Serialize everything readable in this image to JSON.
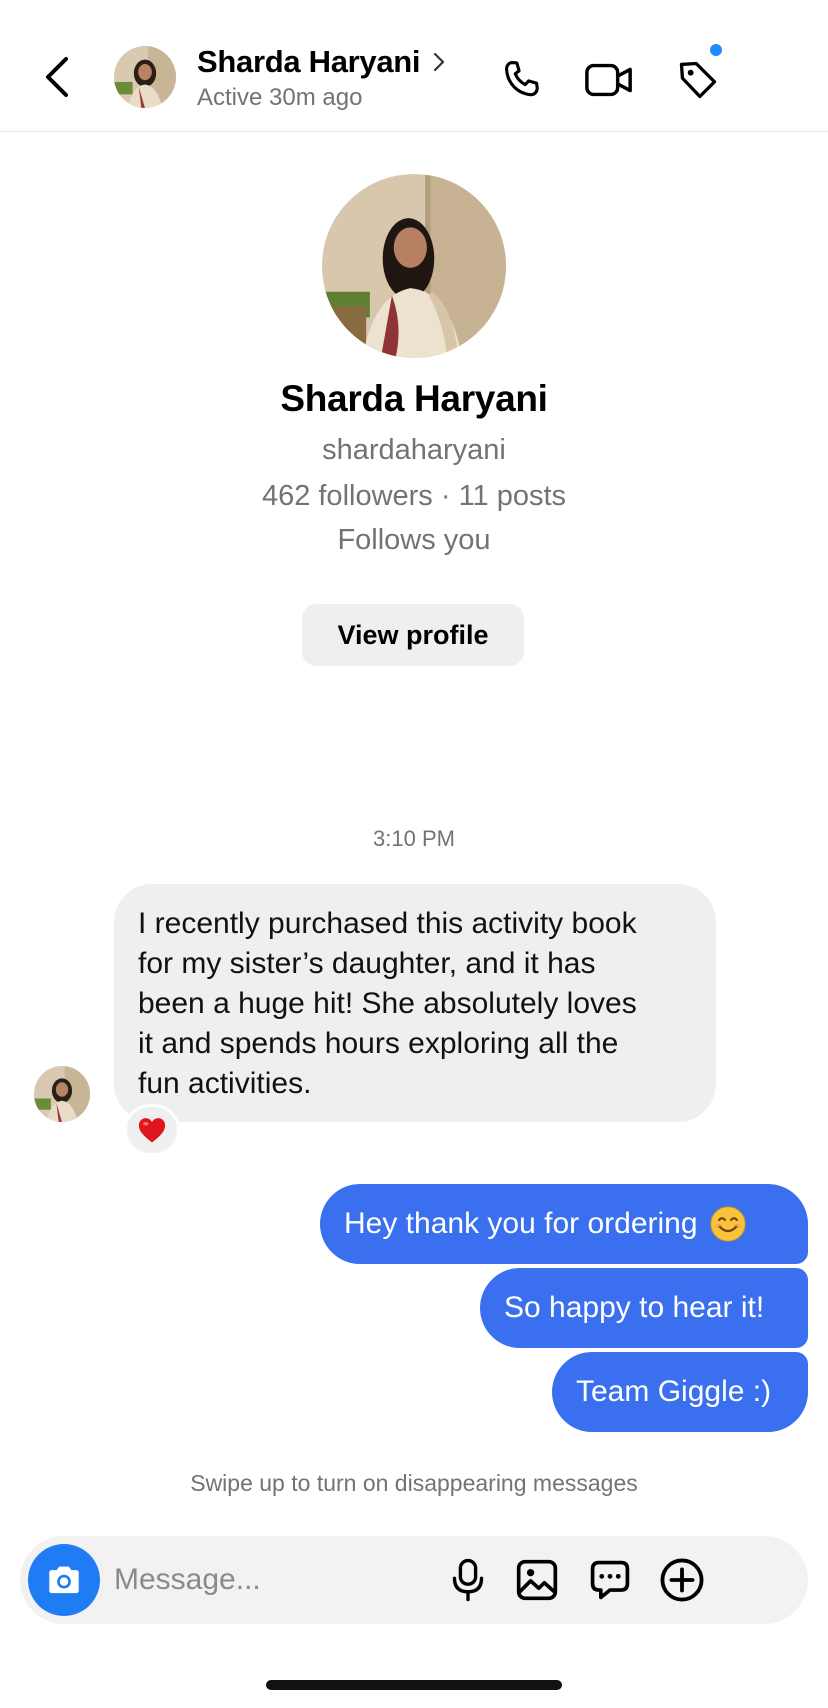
{
  "header": {
    "name": "Sharda Haryani",
    "chevron": "›",
    "status": "Active 30m ago",
    "icons": [
      "chevron-left-icon",
      "phone-icon",
      "video-camera-icon",
      "tag-icon"
    ],
    "notification_dot_color": "#1a8cff"
  },
  "profile": {
    "name": "Sharda Haryani",
    "username": "shardaharyani",
    "stats": "462 followers · 11 posts",
    "follows": "Follows you",
    "view_profile_label": "View profile"
  },
  "conversation": {
    "timestamp": "3:10 PM",
    "incoming": {
      "lines": [
        "I recently purchased this activity book",
        "for my sister’s daughter, and it has",
        "been a huge hit! She absolutely loves",
        "it and spends hours exploring all the",
        "fun activities."
      ],
      "reaction": "❤️"
    },
    "outgoing": [
      {
        "text": "Hey thank you for ordering",
        "emoji": "smiling-face-icon"
      },
      {
        "text": "So happy to hear it!"
      },
      {
        "text": "Team Giggle :)"
      }
    ],
    "swipe_hint": "Swipe up to turn on disappearing messages"
  },
  "composer": {
    "placeholder": "Message...",
    "icons": [
      "camera-icon",
      "microphone-icon",
      "image-icon",
      "sticker-chat-icon",
      "plus-circle-icon"
    ]
  },
  "colors": {
    "outgoing_bubble": "#3a6ff0",
    "incoming_bubble": "#efefef",
    "camera_button": "#1f7cf4",
    "secondary_text": "#737373"
  }
}
